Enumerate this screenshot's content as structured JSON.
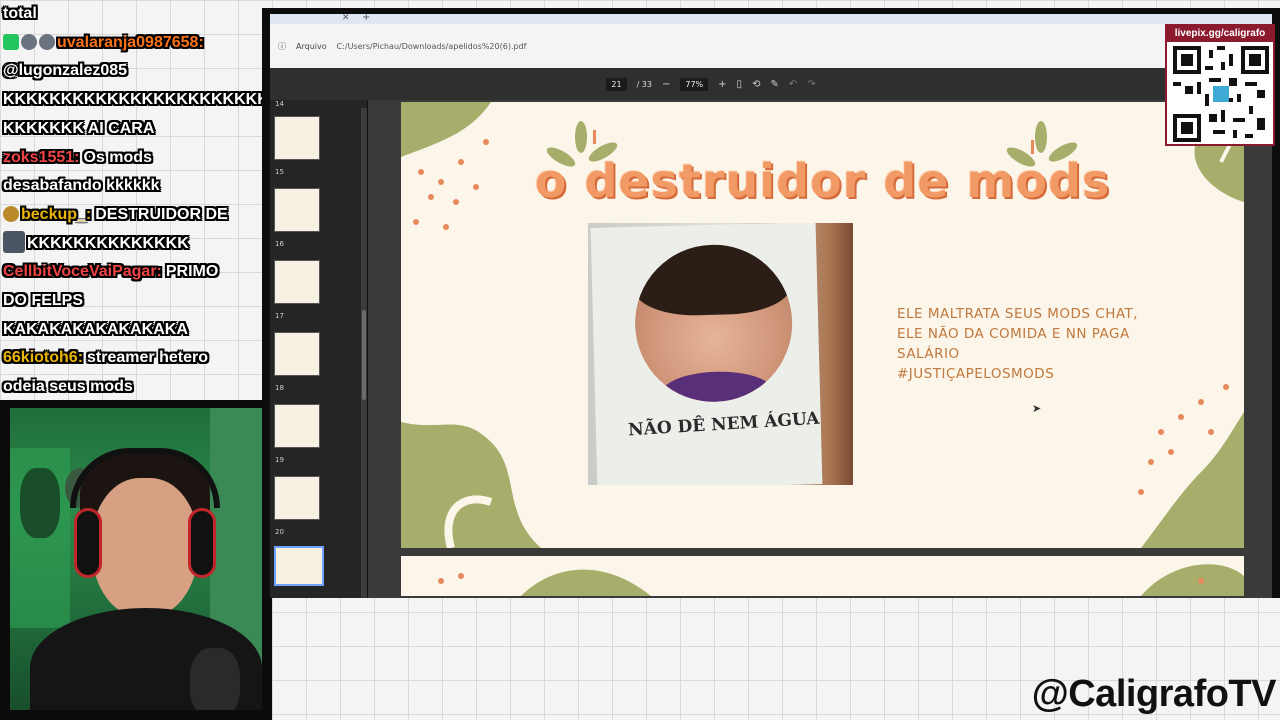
{
  "chat": {
    "lines": [
      {
        "user": "",
        "message": "total",
        "user_color": "#ffffff"
      },
      {
        "user": "uvalaranja0987658:",
        "message": "",
        "user_color": "#f97316",
        "badges": [
          "green",
          "grey",
          "grey"
        ]
      },
      {
        "user": "",
        "message": "@lugonzalez085",
        "user_color": "#ffffff"
      },
      {
        "user": "",
        "message": "KKKKKKKKKKKKKKKKKKKKKKK",
        "user_color": "#ffffff"
      },
      {
        "user": "",
        "message": "KKKKKKK AI CARA",
        "user_color": "#ffffff"
      },
      {
        "user": "zoks1551:",
        "message": "Os mods",
        "user_color": "#ef4444"
      },
      {
        "user": "",
        "message": "desabafando kkkkkk",
        "user_color": "#ffffff"
      },
      {
        "user": "beckup_:",
        "message": "DESTRUIDOR DE",
        "user_color": "#eab308",
        "badges": [
          "gold"
        ]
      },
      {
        "user": "",
        "message": "KKKKKKKKKKKKKK",
        "user_color": "#ffffff",
        "badges": [
          "avatar"
        ]
      },
      {
        "user": "CellbitVoceVaiPagar:",
        "message": "PRIMO",
        "user_color": "#ef4444"
      },
      {
        "user": "",
        "message": "DO FELPS",
        "user_color": "#ffffff"
      },
      {
        "user": "",
        "message": "KAKAKAKAKAKAKAKA",
        "user_color": "#ffffff"
      },
      {
        "user": "66kiotoh6:",
        "message": "streamer hetero",
        "user_color": "#eab308"
      },
      {
        "user": "",
        "message": "odeia seus mods",
        "user_color": "#ffffff"
      }
    ]
  },
  "browser": {
    "file_label": "Arquivo",
    "url": "C:/Users/Pichau/Downloads/apelidos%20(6).pdf",
    "page_current": "21",
    "page_total": "/ 33",
    "zoom": "77%",
    "zoom_out": "−",
    "zoom_in": "+",
    "search_icon": "⌕",
    "star_icon": "☆"
  },
  "thumbnails": {
    "numbers": [
      "14",
      "15",
      "16",
      "17",
      "18",
      "19",
      "20"
    ]
  },
  "slide": {
    "title": "o destruidor de mods",
    "photo_caption": "NÃO DÊ NEM ÁGUA",
    "text_line1": "ELE MALTRATA SEUS MODS CHAT,",
    "text_line2": "ELE NÃO DA COMIDA E NN PAGA",
    "text_line3": "SALÁRIO",
    "text_line4": "#JUSTIÇAPELOSMODS",
    "colors": {
      "title": "#f29a66",
      "text": "#c0783e",
      "leaf": "#a7ad6a",
      "background": "#fbf6e9",
      "accent": "#e8895c"
    }
  },
  "overlay": {
    "qr_label": "livepix.gg/caligrafo",
    "handle": "@CaligrafoTV"
  }
}
